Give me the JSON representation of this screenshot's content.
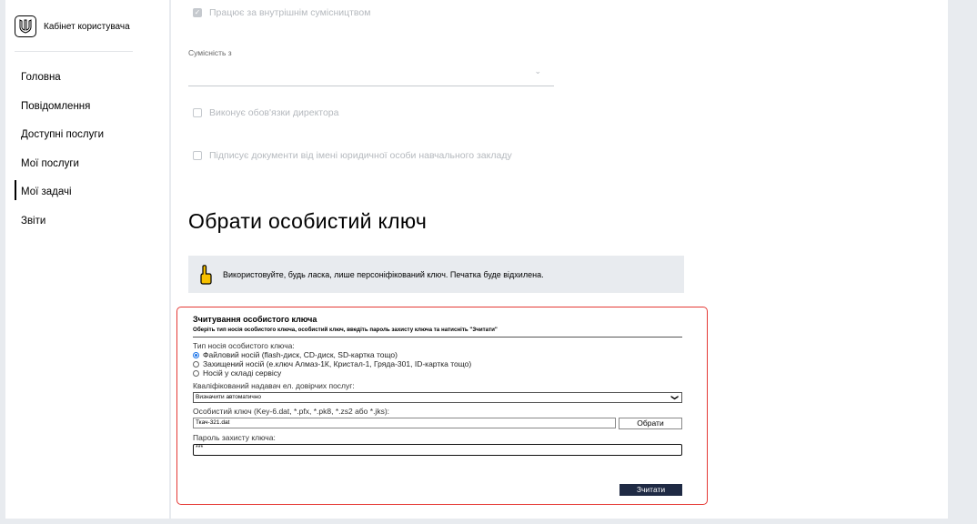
{
  "sidebar": {
    "brand_title": "Кабінет користувача",
    "logo_icon": "trident-icon",
    "items": [
      {
        "label": "Головна",
        "active": false
      },
      {
        "label": "Повідомлення",
        "active": false
      },
      {
        "label": "Доступні послуги",
        "active": false
      },
      {
        "label": "Мої послуги",
        "active": false
      },
      {
        "label": "Мої задачі",
        "active": true
      },
      {
        "label": "Звіти",
        "active": false
      }
    ]
  },
  "form": {
    "internal_combination_label": "Працює за внутрішнім сумісництвом",
    "internal_combination_checked": true,
    "compat_label": "Сумісність з",
    "compat_value": "",
    "director_label": "Виконує обов'язки директора",
    "director_checked": false,
    "sign_label": "Підписує документи від імені юридичної особи навчального закладу",
    "sign_checked": false
  },
  "key_section": {
    "title": "Обрати особистий ключ",
    "notice_text": "Використовуйте, будь ласка, лише персоніфікований ключ. Печатка буде відхилена.",
    "notice_icon": "pointing-hand-icon"
  },
  "key_reader": {
    "title": "Зчитування особистого ключа",
    "subtitle": "Оберіть тип носія особистого ключа, особистий ключ, введіть пароль захисту ключа та натисніть \"Зчитати\"",
    "media_type_label": "Тип носія особистого ключа:",
    "media_options": [
      {
        "label": "Файловий носій (flash-диск, CD-диск, SD-картка тощо)",
        "selected": true
      },
      {
        "label": "Захищений носій (е.ключ Алмаз-1К, Кристал-1, Гряда-301, ID-картка тощо)",
        "selected": false
      },
      {
        "label": "Носій у складі сервісу",
        "selected": false
      }
    ],
    "provider_label": "Кваліфікований надавач ел. довірчих послуг:",
    "provider_value": "Визначити автоматично",
    "key_file_label": "Особистий ключ (Key-6.dat, *.pfx, *.pk8, *.zs2 або *.jks):",
    "key_file_value": "Ткач-321.dat",
    "browse_label": "Обрати",
    "password_label": "Пароль захисту ключа:",
    "password_value": "***",
    "read_button_label": "Зчитати"
  }
}
